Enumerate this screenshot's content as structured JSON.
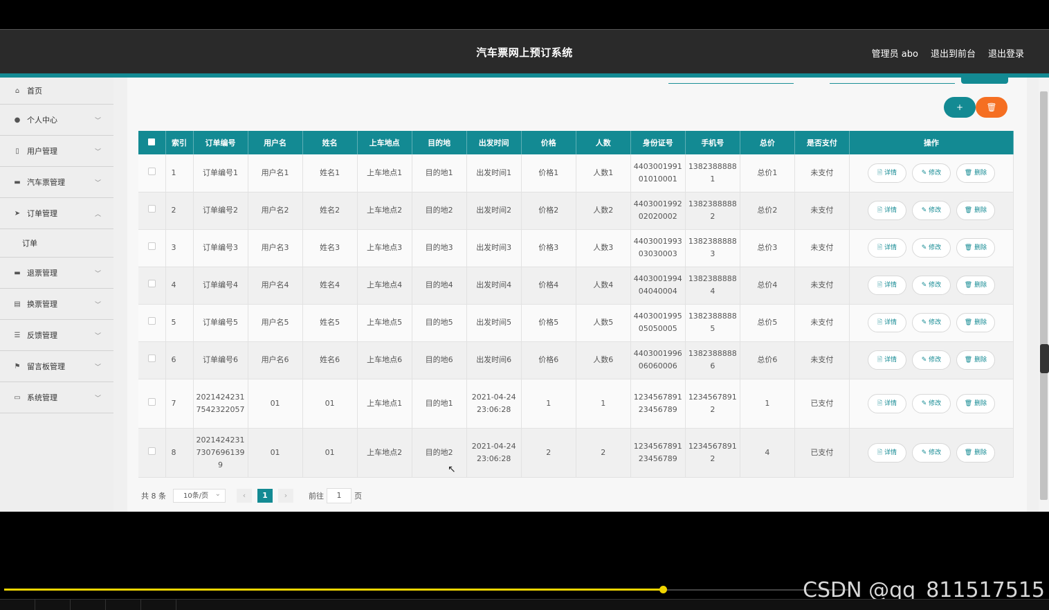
{
  "header": {
    "title": "汽车票网上预订系统",
    "admin": "管理员 abo",
    "to_front": "退出到前台",
    "logout": "退出登录"
  },
  "sidebar": {
    "items": [
      {
        "label": "首页",
        "icon": "home-icon",
        "glyph": "⌂"
      },
      {
        "label": "个人中心",
        "icon": "user-icon",
        "glyph": "●"
      },
      {
        "label": "用户管理",
        "icon": "phone-icon",
        "glyph": "▯"
      },
      {
        "label": "汽车票管理",
        "icon": "monitor-icon",
        "glyph": "▬"
      },
      {
        "label": "订单管理",
        "icon": "send-icon",
        "glyph": "➤"
      },
      {
        "label": "退票管理",
        "icon": "monitor-icon",
        "glyph": "▬"
      },
      {
        "label": "换票管理",
        "icon": "list-icon",
        "glyph": "▤"
      },
      {
        "label": "反馈管理",
        "icon": "sliders-icon",
        "glyph": "☰"
      },
      {
        "label": "留言板管理",
        "icon": "flag-icon",
        "glyph": "⚑"
      },
      {
        "label": "系统管理",
        "icon": "briefcase-icon",
        "glyph": "▭"
      }
    ],
    "sub": "订单"
  },
  "toolbar": {
    "add": "+",
    "del": "🗑"
  },
  "table": {
    "columns": [
      "索引",
      "订单编号",
      "用户名",
      "姓名",
      "上车地点",
      "目的地",
      "出发时间",
      "价格",
      "人数",
      "身份证号",
      "手机号",
      "总价",
      "是否支付",
      "操作"
    ],
    "rows": [
      [
        "1",
        "订单编号1",
        "用户名1",
        "姓名1",
        "上车地点1",
        "目的地1",
        "出发时间1",
        "价格1",
        "人数1",
        "440300199101010001",
        "13823888881",
        "总价1",
        "未支付"
      ],
      [
        "2",
        "订单编号2",
        "用户名2",
        "姓名2",
        "上车地点2",
        "目的地2",
        "出发时间2",
        "价格2",
        "人数2",
        "440300199202020002",
        "13823888882",
        "总价2",
        "未支付"
      ],
      [
        "3",
        "订单编号3",
        "用户名3",
        "姓名3",
        "上车地点3",
        "目的地3",
        "出发时间3",
        "价格3",
        "人数3",
        "440300199303030003",
        "13823888883",
        "总价3",
        "未支付"
      ],
      [
        "4",
        "订单编号4",
        "用户名4",
        "姓名4",
        "上车地点4",
        "目的地4",
        "出发时间4",
        "价格4",
        "人数4",
        "440300199404040004",
        "13823888884",
        "总价4",
        "未支付"
      ],
      [
        "5",
        "订单编号5",
        "用户名5",
        "姓名5",
        "上车地点5",
        "目的地5",
        "出发时间5",
        "价格5",
        "人数5",
        "440300199505050005",
        "13823888885",
        "总价5",
        "未支付"
      ],
      [
        "6",
        "订单编号6",
        "用户名6",
        "姓名6",
        "上车地点6",
        "目的地6",
        "出发时间6",
        "价格6",
        "人数6",
        "440300199606060006",
        "13823888886",
        "总价6",
        "未支付"
      ],
      [
        "7",
        "20214242317542322057",
        "01",
        "01",
        "上车地点1",
        "目的地1",
        "2021-04-24 23:06:28",
        "1",
        "1",
        "123456789123456789",
        "12345678912",
        "1",
        "已支付"
      ],
      [
        "8",
        "202142423173076961399",
        "01",
        "01",
        "上车地点2",
        "目的地2",
        "2021-04-24 23:06:28",
        "2",
        "2",
        "123456789123456789",
        "12345678912",
        "4",
        "已支付"
      ]
    ],
    "actions": {
      "detail": "🗎 详情",
      "edit": "✎ 修改",
      "delete": "🗑 删除"
    }
  },
  "pager": {
    "total": "共 8 条",
    "size": "10条/页",
    "current": "1",
    "goto": "前往",
    "goto_value": "1",
    "page_unit": "页"
  },
  "player": {
    "watermark": "CSDN @qq_811517515",
    "progress": 0.78
  }
}
